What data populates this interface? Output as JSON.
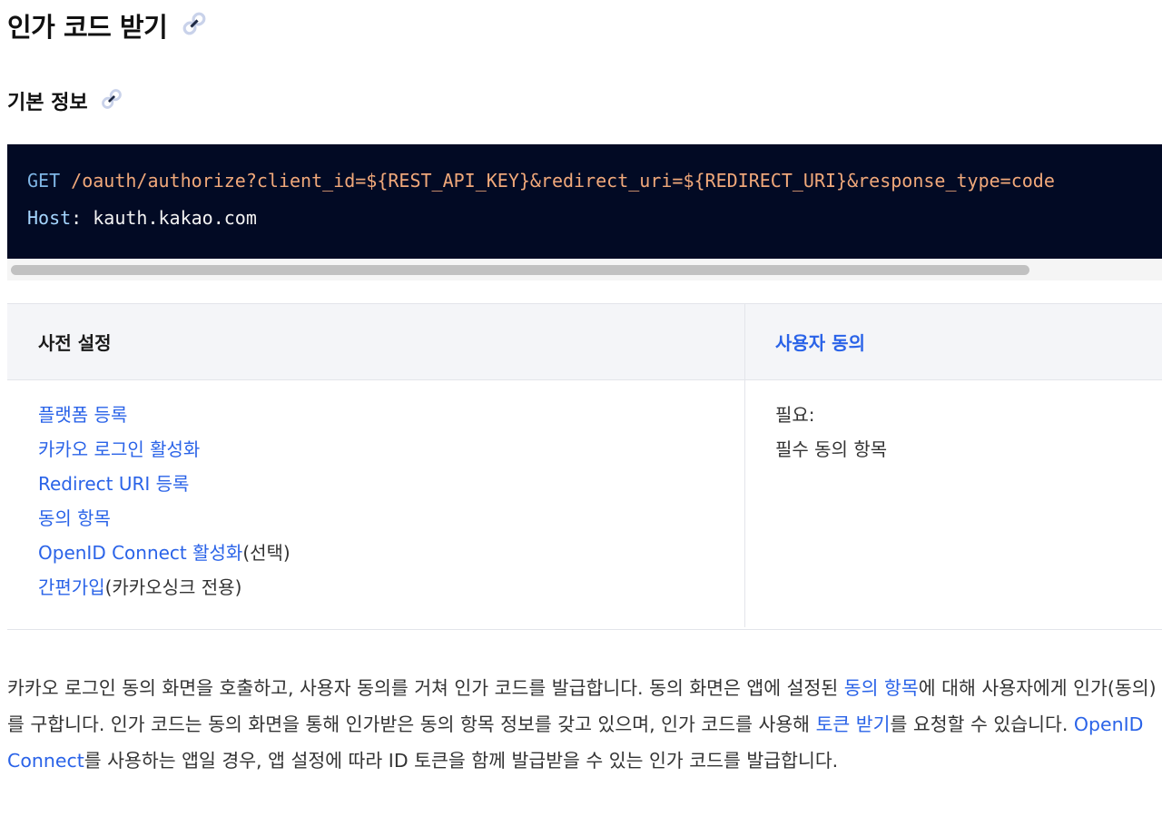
{
  "heading": {
    "title": "인가 코드 받기",
    "icon": "link-icon"
  },
  "subheading": {
    "title": "기본 정보",
    "icon": "link-icon"
  },
  "code": {
    "method": "GET",
    "path": "/oauth/authorize?client_id=${REST_API_KEY}&redirect_uri=${REDIRECT_URI}&response_type=code",
    "host_key": "Host",
    "host_sep": ":",
    "host_value": "kauth.kakao.com",
    "colors": {
      "background": "#020a24",
      "method": "#7fb6e6",
      "path": "#f0a87a",
      "host_key": "#a5d6ff"
    }
  },
  "table": {
    "header_prereq": "사전 설정",
    "header_consent": "사용자 동의",
    "prereq": {
      "platform": "플랫폼 등록",
      "kakao_login": "카카오 로그인 활성화",
      "redirect_uri": "Redirect URI 등록",
      "consent_items": "동의 항목",
      "oidc_link": "OpenID Connect 활성화",
      "oidc_note": "(선택)",
      "simple_signup_link": "간편가입",
      "simple_signup_note": "(카카오싱크 전용)"
    },
    "consent": {
      "required_label": "필요:",
      "required_value": "필수 동의 항목"
    }
  },
  "description": {
    "t1": "카카오 로그인 동의 화면을 호출하고, 사용자 동의를 거쳐 인가 코드를 발급합니다. 동의 화면은 앱에 설정된 ",
    "l1": "동의 항목",
    "t2": "에 대해 사용자에게 인가(동의)를 구합니다. 인가 코드는 동의 화면을 통해 인가받은 동의 항목 정보를 갖고 있으며, 인가 코드를 사용해 ",
    "l2": "토큰 받기",
    "t3": "를 요청할 수 있습니다. ",
    "l3": "OpenID Connect",
    "t4": "를 사용하는 앱일 경우, 앱 설정에 따라 ID 토큰을 함께 발급받을 수 있는 인가 코드를 발급합니다."
  },
  "colors": {
    "link": "#2a63e8",
    "table_header_bg": "#f4f5f8"
  }
}
